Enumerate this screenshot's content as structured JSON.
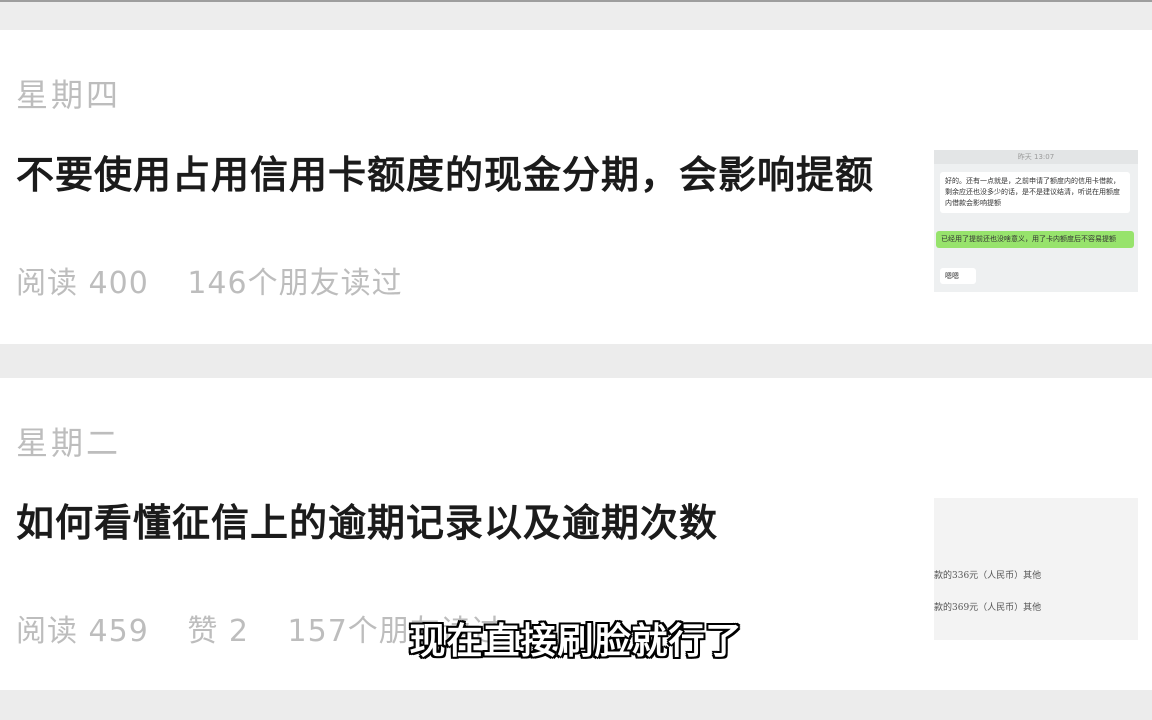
{
  "articles": [
    {
      "day": "星期四",
      "title": "不要使用占用信用卡额度的现金分期，会影响提额",
      "reads": "阅读 400",
      "likes": "",
      "friends": "146个朋友读过",
      "thumbnail": {
        "type": "chat",
        "header": "昨天 13:07",
        "message_left": "好的。还有一点就是，之前申请了额度内的信用卡借款，剩余应还也没多少的话，是不是建议结清，听说在用额度内借款会影响提额",
        "message_green": "已经用了提前还也没啥意义，用了卡内额度后不容易提额",
        "message_reply": "嗯嗯"
      }
    },
    {
      "day": "星期二",
      "title": "如何看懂征信上的逾期记录以及逾期次数",
      "reads": "阅读 459",
      "likes": "赞 2",
      "friends": "157个朋友读过",
      "thumbnail": {
        "type": "document",
        "line_1": "款的336元（人民币）其他",
        "line_2": "款的369元（人民币）其他"
      }
    }
  ],
  "subtitle": "现在直接刷脸就行了"
}
